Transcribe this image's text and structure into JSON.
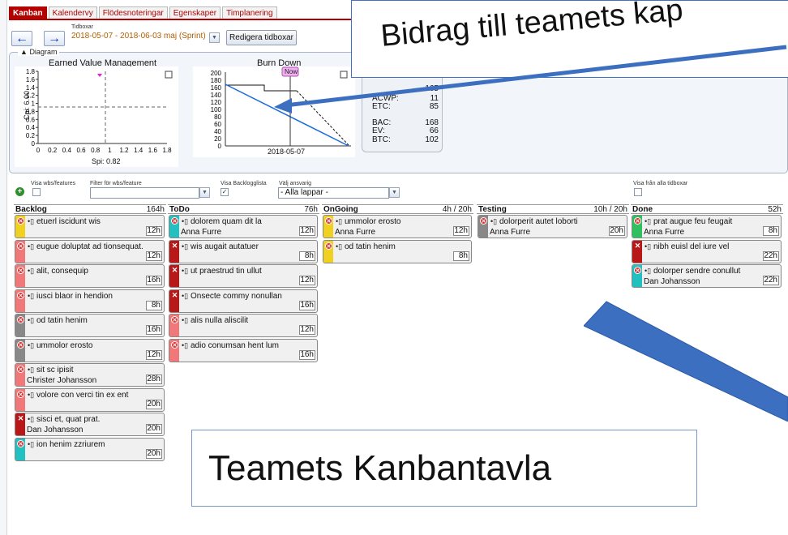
{
  "tabs": [
    "Kanban",
    "Kalendervy",
    "Flödesnoteringar",
    "Egenskaper",
    "Timplanering"
  ],
  "toolbar": {
    "tidboxar_label": "Tidboxar",
    "tidboxar_value": "2018-05-07 - 2018-06-03 maj (Sprint)",
    "edit_button": "Redigera tidboxar"
  },
  "diagram": {
    "legend": "Diagram",
    "evm": {
      "title": "Earned Value Management",
      "ylabel": "Cpi: 6.00",
      "xlabel": "Spi: 0.82",
      "yticks": [
        "1.8",
        "1.6",
        "1.4",
        "1.2",
        "1",
        "0.8",
        "0.6",
        "0.4",
        "0.2",
        "0"
      ],
      "xticks": [
        "0",
        "0.2",
        "0.4",
        "0.6",
        "0.8",
        "1",
        "1.2",
        "1.4",
        "1.6",
        "1.8"
      ]
    },
    "burndown": {
      "title": "Burn Down",
      "now_badge": "Now",
      "xlabel": "2018-05-07",
      "yticks": [
        "200",
        "180",
        "160",
        "140",
        "120",
        "100",
        "80",
        "60",
        "40",
        "20",
        "0"
      ]
    },
    "metrics": [
      {
        "label": "",
        "value": "165"
      },
      {
        "label": "ACWP:",
        "value": "11"
      },
      {
        "label": "ETC:",
        "value": "85"
      },
      {
        "label": "BAC:",
        "value": "168"
      },
      {
        "label": "EV:",
        "value": "66"
      },
      {
        "label": "BTC:",
        "value": "102"
      }
    ]
  },
  "callouts": {
    "top": "Bidrag till teamets kap",
    "bottom": "Teamets Kanbantavla"
  },
  "filters": {
    "visa_wbs": "Visa wbs/features",
    "filter_wbs": "Filter för wbs/feature",
    "visa_backlog": "Visa Backlogglista",
    "valj_ansvarig": "Välj ansvarig",
    "ansvarig_value": "- Alla lappar -",
    "visa_alla": "Visa från alla tidboxar"
  },
  "columns": [
    {
      "name": "Backlog",
      "hours": "164h",
      "cards": [
        {
          "title": "etuerl iscidunt wis",
          "owner": "",
          "hours": "12h",
          "color": "#f0d020",
          "x": "circle"
        },
        {
          "title": "eugue doluptat ad tionsequat.",
          "owner": "",
          "hours": "12h",
          "color": "#f07878",
          "x": "circle"
        },
        {
          "title": "alit, consequip",
          "owner": "",
          "hours": "16h",
          "color": "#f07878",
          "x": "circle"
        },
        {
          "title": "iusci blaor in hendion",
          "owner": "",
          "hours": "8h",
          "color": "#f07878",
          "x": "circle"
        },
        {
          "title": "od tatin henim",
          "owner": "",
          "hours": "16h",
          "color": "#888888",
          "x": "circle"
        },
        {
          "title": "ummolor erosto",
          "owner": "",
          "hours": "12h",
          "color": "#888888",
          "x": "circle"
        },
        {
          "title": "sit sc ipisit",
          "owner": "Christer Johansson",
          "hours": "28h",
          "color": "#f07878",
          "x": "circle"
        },
        {
          "title": "volore con verci tin ex ent",
          "owner": "",
          "hours": "20h",
          "color": "#f07878",
          "x": "circle"
        },
        {
          "title": "sisci et, quat prat.",
          "owner": "Dan Johansson",
          "hours": "20h",
          "color": "#b81818",
          "x": "square"
        },
        {
          "title": "ion henim zzriurem",
          "owner": "",
          "hours": "20h",
          "color": "#22c0c0",
          "x": "circle"
        }
      ]
    },
    {
      "name": "ToDo",
      "hours": "76h",
      "cards": [
        {
          "title": "dolorem quam dit la",
          "owner": "Anna Furre",
          "hours": "12h",
          "color": "#22c0c0",
          "x": "circle"
        },
        {
          "title": "wis augait autatuer",
          "owner": "",
          "hours": "8h",
          "color": "#b81818",
          "x": "square"
        },
        {
          "title": "ut praestrud tin ullut",
          "owner": "",
          "hours": "12h",
          "color": "#b81818",
          "x": "square"
        },
        {
          "title": "Onsecte commy nonullan",
          "owner": "",
          "hours": "16h",
          "color": "#b81818",
          "x": "square"
        },
        {
          "title": "alis nulla aliscilit",
          "owner": "",
          "hours": "12h",
          "color": "#f07878",
          "x": "circle"
        },
        {
          "title": "adio conumsan hent lum",
          "owner": "",
          "hours": "16h",
          "color": "#f07878",
          "x": "circle"
        }
      ]
    },
    {
      "name": "OnGoing",
      "hours": "4h / 20h",
      "cards": [
        {
          "title": "ummolor erosto",
          "owner": "Anna Furre",
          "hours": "12h",
          "color": "#f0d020",
          "x": "circle"
        },
        {
          "title": "od tatin henim",
          "owner": "",
          "hours": "8h",
          "color": "#f0d020",
          "x": "circle"
        }
      ]
    },
    {
      "name": "Testing",
      "hours": "10h / 20h",
      "cards": [
        {
          "title": "dolorperit autet loborti",
          "owner": "Anna Furre",
          "hours": "20h",
          "color": "#888888",
          "x": "circle"
        }
      ]
    },
    {
      "name": "Done",
      "hours": "52h",
      "cards": [
        {
          "title": "prat augue feu feugait",
          "owner": "Anna Furre",
          "hours": "8h",
          "color": "#30c060",
          "x": "circle"
        },
        {
          "title": "nibh euisl del iure vel",
          "owner": "",
          "hours": "22h",
          "color": "#b81818",
          "x": "square"
        },
        {
          "title": "dolorper sendre conullut",
          "owner": "Dan Johansson",
          "hours": "22h",
          "color": "#22c0c0",
          "x": "circle"
        }
      ]
    }
  ]
}
